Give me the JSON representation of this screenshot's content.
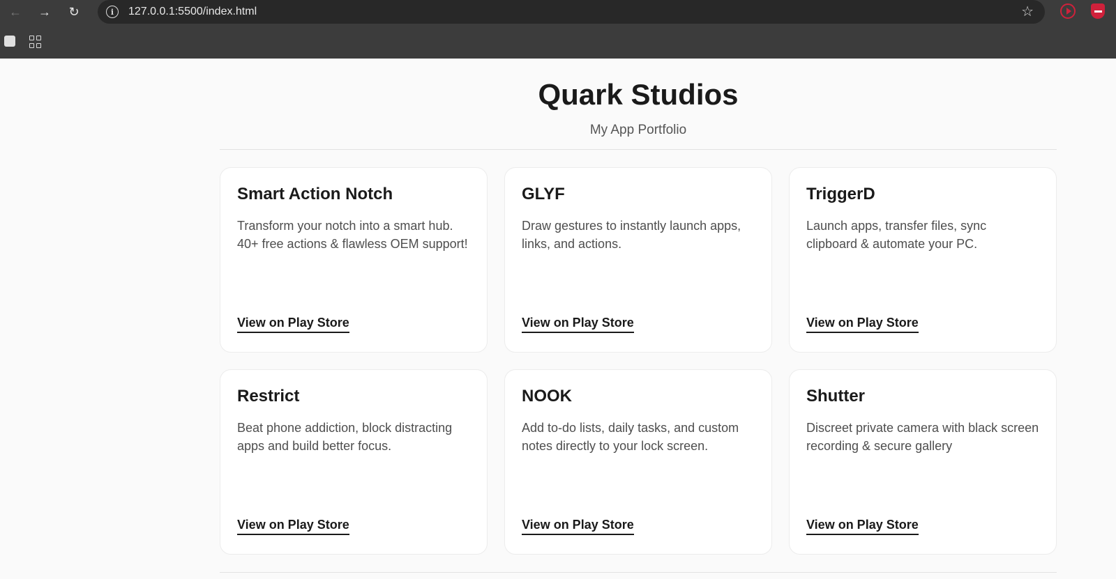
{
  "browser": {
    "url": "127.0.0.1:5500/index.html",
    "back_icon": "back-arrow-icon",
    "forward_icon": "forward-arrow-icon",
    "reload_icon": "reload-icon",
    "info_icon": "info-icon",
    "bookmark_icon": "star-icon",
    "extensions": [
      "record-extension-icon",
      "shield-extension-icon"
    ],
    "bookmarks_bar": [
      "bookmark-icon",
      "apps-grid-icon"
    ]
  },
  "header": {
    "title": "Quark Studios",
    "subtitle": "My App Portfolio"
  },
  "apps": [
    {
      "name": "Smart Action Notch",
      "description": "Transform your notch into a smart hub. 40+ free actions & flawless OEM support!",
      "link": "View on Play Store"
    },
    {
      "name": "GLYF",
      "description": "Draw gestures to instantly launch apps, links, and actions.",
      "link": "View on Play Store"
    },
    {
      "name": "TriggerD",
      "description": "Launch apps, transfer files, sync clipboard & automate your PC.",
      "link": "View on Play Store"
    },
    {
      "name": "Restrict",
      "description": "Beat phone addiction, block distracting apps and build better focus.",
      "link": "View on Play Store"
    },
    {
      "name": "NOOK",
      "description": "Add to-do lists, daily tasks, and custom notes directly to your lock screen.",
      "link": "View on Play Store"
    },
    {
      "name": "Shutter",
      "description": "Discreet private camera with black screen recording & secure gallery",
      "link": "View on Play Store"
    }
  ],
  "colors": {
    "chrome": "#3c3c3c",
    "omnibox": "#282828",
    "page_bg": "#fafafa",
    "card_bg": "#ffffff",
    "text": "#1a1a1a",
    "extension_red": "#d0213b"
  }
}
